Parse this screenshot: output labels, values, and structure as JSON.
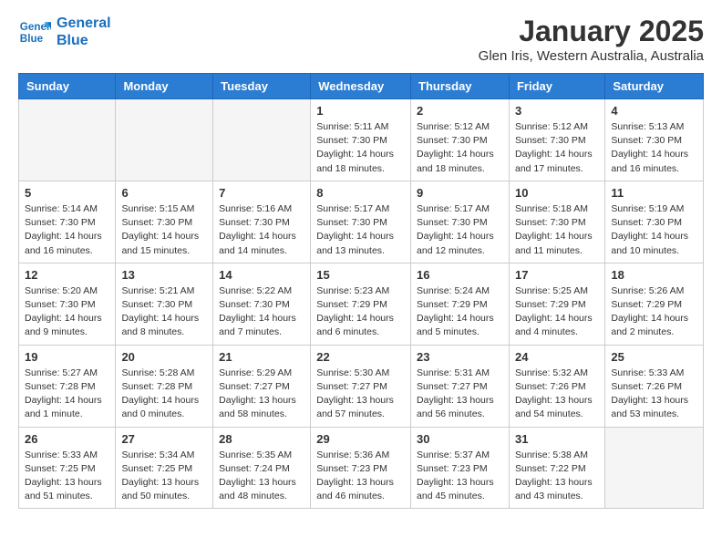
{
  "header": {
    "logo_line1": "General",
    "logo_line2": "Blue",
    "title": "January 2025",
    "subtitle": "Glen Iris, Western Australia, Australia"
  },
  "weekdays": [
    "Sunday",
    "Monday",
    "Tuesday",
    "Wednesday",
    "Thursday",
    "Friday",
    "Saturday"
  ],
  "weeks": [
    [
      {
        "date": "",
        "info": ""
      },
      {
        "date": "",
        "info": ""
      },
      {
        "date": "",
        "info": ""
      },
      {
        "date": "1",
        "info": "Sunrise: 5:11 AM\nSunset: 7:30 PM\nDaylight: 14 hours\nand 18 minutes."
      },
      {
        "date": "2",
        "info": "Sunrise: 5:12 AM\nSunset: 7:30 PM\nDaylight: 14 hours\nand 18 minutes."
      },
      {
        "date": "3",
        "info": "Sunrise: 5:12 AM\nSunset: 7:30 PM\nDaylight: 14 hours\nand 17 minutes."
      },
      {
        "date": "4",
        "info": "Sunrise: 5:13 AM\nSunset: 7:30 PM\nDaylight: 14 hours\nand 16 minutes."
      }
    ],
    [
      {
        "date": "5",
        "info": "Sunrise: 5:14 AM\nSunset: 7:30 PM\nDaylight: 14 hours\nand 16 minutes."
      },
      {
        "date": "6",
        "info": "Sunrise: 5:15 AM\nSunset: 7:30 PM\nDaylight: 14 hours\nand 15 minutes."
      },
      {
        "date": "7",
        "info": "Sunrise: 5:16 AM\nSunset: 7:30 PM\nDaylight: 14 hours\nand 14 minutes."
      },
      {
        "date": "8",
        "info": "Sunrise: 5:17 AM\nSunset: 7:30 PM\nDaylight: 14 hours\nand 13 minutes."
      },
      {
        "date": "9",
        "info": "Sunrise: 5:17 AM\nSunset: 7:30 PM\nDaylight: 14 hours\nand 12 minutes."
      },
      {
        "date": "10",
        "info": "Sunrise: 5:18 AM\nSunset: 7:30 PM\nDaylight: 14 hours\nand 11 minutes."
      },
      {
        "date": "11",
        "info": "Sunrise: 5:19 AM\nSunset: 7:30 PM\nDaylight: 14 hours\nand 10 minutes."
      }
    ],
    [
      {
        "date": "12",
        "info": "Sunrise: 5:20 AM\nSunset: 7:30 PM\nDaylight: 14 hours\nand 9 minutes."
      },
      {
        "date": "13",
        "info": "Sunrise: 5:21 AM\nSunset: 7:30 PM\nDaylight: 14 hours\nand 8 minutes."
      },
      {
        "date": "14",
        "info": "Sunrise: 5:22 AM\nSunset: 7:30 PM\nDaylight: 14 hours\nand 7 minutes."
      },
      {
        "date": "15",
        "info": "Sunrise: 5:23 AM\nSunset: 7:29 PM\nDaylight: 14 hours\nand 6 minutes."
      },
      {
        "date": "16",
        "info": "Sunrise: 5:24 AM\nSunset: 7:29 PM\nDaylight: 14 hours\nand 5 minutes."
      },
      {
        "date": "17",
        "info": "Sunrise: 5:25 AM\nSunset: 7:29 PM\nDaylight: 14 hours\nand 4 minutes."
      },
      {
        "date": "18",
        "info": "Sunrise: 5:26 AM\nSunset: 7:29 PM\nDaylight: 14 hours\nand 2 minutes."
      }
    ],
    [
      {
        "date": "19",
        "info": "Sunrise: 5:27 AM\nSunset: 7:28 PM\nDaylight: 14 hours\nand 1 minute."
      },
      {
        "date": "20",
        "info": "Sunrise: 5:28 AM\nSunset: 7:28 PM\nDaylight: 14 hours\nand 0 minutes."
      },
      {
        "date": "21",
        "info": "Sunrise: 5:29 AM\nSunset: 7:27 PM\nDaylight: 13 hours\nand 58 minutes."
      },
      {
        "date": "22",
        "info": "Sunrise: 5:30 AM\nSunset: 7:27 PM\nDaylight: 13 hours\nand 57 minutes."
      },
      {
        "date": "23",
        "info": "Sunrise: 5:31 AM\nSunset: 7:27 PM\nDaylight: 13 hours\nand 56 minutes."
      },
      {
        "date": "24",
        "info": "Sunrise: 5:32 AM\nSunset: 7:26 PM\nDaylight: 13 hours\nand 54 minutes."
      },
      {
        "date": "25",
        "info": "Sunrise: 5:33 AM\nSunset: 7:26 PM\nDaylight: 13 hours\nand 53 minutes."
      }
    ],
    [
      {
        "date": "26",
        "info": "Sunrise: 5:33 AM\nSunset: 7:25 PM\nDaylight: 13 hours\nand 51 minutes."
      },
      {
        "date": "27",
        "info": "Sunrise: 5:34 AM\nSunset: 7:25 PM\nDaylight: 13 hours\nand 50 minutes."
      },
      {
        "date": "28",
        "info": "Sunrise: 5:35 AM\nSunset: 7:24 PM\nDaylight: 13 hours\nand 48 minutes."
      },
      {
        "date": "29",
        "info": "Sunrise: 5:36 AM\nSunset: 7:23 PM\nDaylight: 13 hours\nand 46 minutes."
      },
      {
        "date": "30",
        "info": "Sunrise: 5:37 AM\nSunset: 7:23 PM\nDaylight: 13 hours\nand 45 minutes."
      },
      {
        "date": "31",
        "info": "Sunrise: 5:38 AM\nSunset: 7:22 PM\nDaylight: 13 hours\nand 43 minutes."
      },
      {
        "date": "",
        "info": ""
      }
    ]
  ]
}
